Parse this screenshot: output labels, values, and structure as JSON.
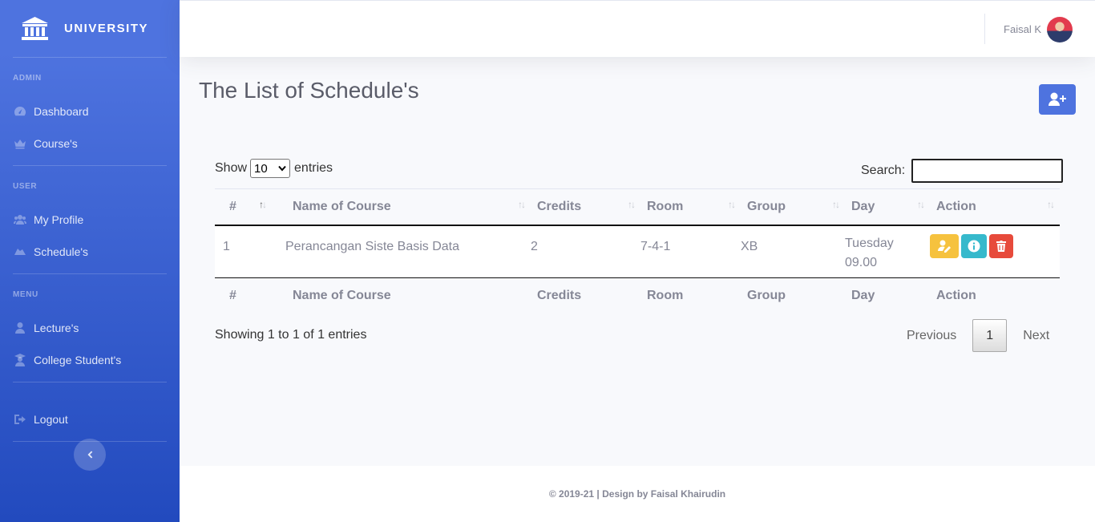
{
  "sidebar": {
    "brand": "UNIVERSITY",
    "sections": {
      "admin": "ADMIN",
      "user": "USER",
      "menu": "MENU"
    },
    "items": {
      "dashboard": "Dashboard",
      "courses": "Course's",
      "my_profile": "My Profile",
      "schedules": "Schedule's",
      "lectures": "Lecture's",
      "students": "College Student's",
      "logout": "Logout"
    }
  },
  "topbar": {
    "user_name": "Faisal K"
  },
  "main": {
    "title": "The List of Schedule's",
    "show_label": "Show",
    "entries_value": "10",
    "entries_label": "entries",
    "search_label": "Search:",
    "search_value": "",
    "columns": [
      "#",
      "Name of Course",
      "Credits",
      "Room",
      "Group",
      "Day",
      "Action"
    ],
    "rows": [
      {
        "no": "1",
        "course": "Perancangan Siste Basis Data",
        "credits": "2",
        "room": "7-4-1",
        "group": "XB",
        "day": "Tuesday",
        "time": "09.00"
      }
    ],
    "info": "Showing 1 to 1 of 1 entries",
    "pagination": {
      "previous": "Previous",
      "current": "1",
      "next": "Next"
    }
  },
  "footer": {
    "text": "© 2019-21 | Design by Faisal Khairudin"
  },
  "colors": {
    "primary": "#4e73df",
    "warning": "#f6c23e",
    "info": "#36b9cc",
    "danger": "#e74a3b"
  }
}
